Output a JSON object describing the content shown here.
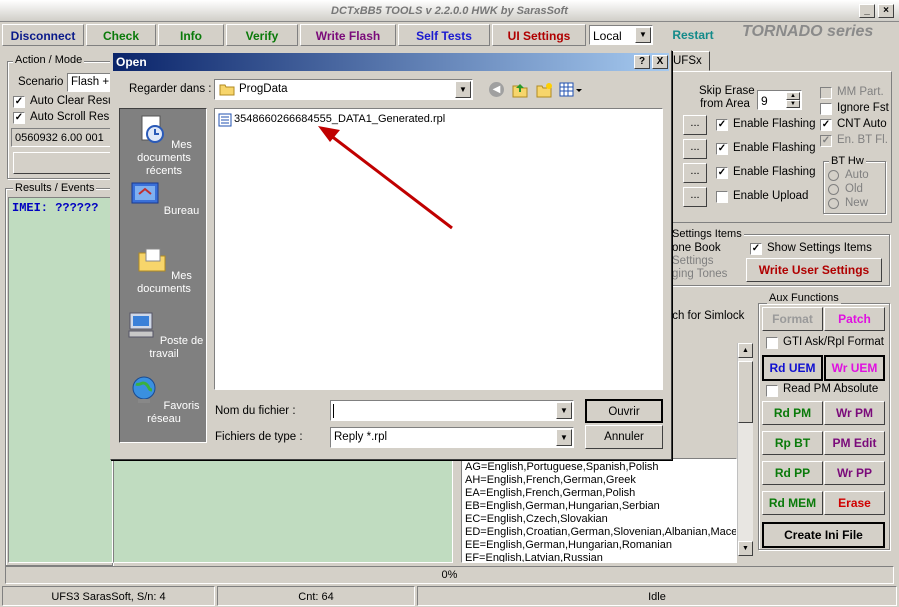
{
  "window": {
    "title": "DCTxBB5 TOOLS v 2.2.0.0 HWK by SarasSoft"
  },
  "toolbar": {
    "items": [
      {
        "label": "Disconnect",
        "color": "#0a1a8a"
      },
      {
        "label": "Check",
        "color": "#0a7a0a"
      },
      {
        "label": "Info",
        "color": "#0a7a0a"
      },
      {
        "label": "Verify",
        "color": "#0a7a0a"
      },
      {
        "label": "Write Flash",
        "color": "#7a0a7a"
      },
      {
        "label": "Self Tests",
        "color": "#1a1ad0"
      },
      {
        "label": "UI Settings",
        "color": "#b00000"
      }
    ],
    "mode_select": "Local",
    "restart": "Restart",
    "brand": "TORNADO series"
  },
  "left": {
    "action_group": "Action / Mode",
    "scenario_label": "Scenario",
    "scenario_value": "Flash +",
    "auto_clear": "Auto Clear Resu",
    "auto_scroll": "Auto Scroll Resu",
    "version_field": "0560932 6.00 001",
    "results_group": "Results / Events",
    "results_text": "IMEI: ??????"
  },
  "right": {
    "tab": "UFSx",
    "skip_erase": "Skip Erase\nfrom Area",
    "skip_value": "9",
    "ellipsis": "...",
    "enable_flashing": "Enable Flashing",
    "enable_upload": "Enable Upload",
    "mm_part": "MM Part.",
    "ignore_fst": "Ignore Fst",
    "cnt_auto": "CNT Auto",
    "en_bt_fl": "En. BT Fl.",
    "bt_hw": "BT Hw",
    "bt_auto": "Auto",
    "bt_old": "Old",
    "bt_new": "New",
    "settings_group": "Settings Items",
    "phone_book": "one Book",
    "settings_partial": "Settings",
    "ging_tones": "ging Tones",
    "show_settings": "Show Settings Items",
    "write_user_settings": "Write User Settings",
    "tch_simlock": "tch for Simlock",
    "languages": [
      "AG=English,Portuguese,Spanish,Polish",
      "AH=English,French,German,Greek",
      "EA=English,French,German,Polish",
      "EB=English,German,Hungarian,Serbian",
      "EC=English,Czech,Slovakian",
      "ED=English,Croatian,German,Slovenian,Albanian,Macedo",
      "EE=English,German,Hungarian,Romanian",
      "EF=English,Latvian,Russian"
    ]
  },
  "aux": {
    "group": "Aux Functions",
    "format": "Format",
    "patch": "Patch",
    "gti": "GTI Ask/Rpl Format",
    "rd_uem": "Rd UEM",
    "wr_uem": "Wr UEM",
    "read_pm_absolute": "Read PM Absolute",
    "rd_pm": "Rd PM",
    "wr_pm": "Wr PM",
    "rp_bt": "Rp BT",
    "pm_edit": "PM Edit",
    "rd_pp": "Rd PP",
    "wr_pp": "Wr PP",
    "rd_mem": "Rd MEM",
    "erase": "Erase",
    "create_ini": "Create Ini File"
  },
  "progress": {
    "value": 0,
    "text": "0%"
  },
  "statusbar": {
    "serial": "UFS3 SarasSoft, S/n: 4",
    "cnt": "Cnt: 64",
    "state": "Idle"
  },
  "dialog": {
    "title": "Open",
    "help": "?",
    "close": "X",
    "look_in_label": "Regarder dans :",
    "look_in_value": "ProgData",
    "places": [
      "Mes documents récents",
      "Bureau",
      "Mes documents",
      "Poste de travail",
      "Favoris réseau"
    ],
    "file": "3548660266684555_DATA1_Generated.rpl",
    "filename_label": "Nom du fichier :",
    "filename_value": "",
    "filetype_label": "Fichiers de type :",
    "filetype_value": "Reply *.rpl",
    "open_button": "Ouvrir",
    "cancel_button": "Annuler"
  },
  "colors": {
    "results_bg": "#c0dcc0",
    "dialog_title": "#0a246a",
    "arrow": "#c00000",
    "brand": "#8a8a8a"
  }
}
